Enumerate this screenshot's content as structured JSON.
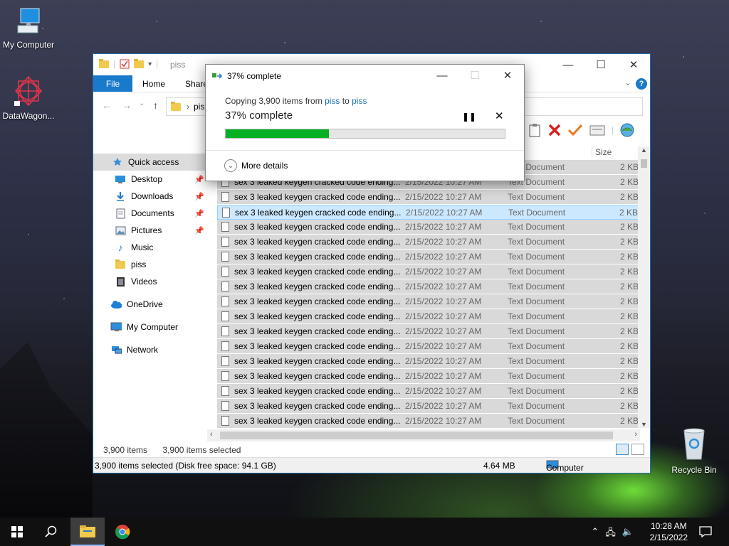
{
  "desktop": {
    "icons": [
      {
        "label": "My Computer"
      },
      {
        "label": "DataWagon..."
      },
      {
        "label": "Recycle Bin"
      }
    ]
  },
  "explorer": {
    "title": "piss",
    "tabs": [
      "File",
      "Home",
      "Share"
    ],
    "address": "pis",
    "sidebar": [
      {
        "label": "Quick access",
        "icon": "star-icon"
      },
      {
        "label": "Desktop",
        "icon": "desktop-icon",
        "pinned": true
      },
      {
        "label": "Downloads",
        "icon": "download-icon",
        "pinned": true
      },
      {
        "label": "Documents",
        "icon": "documents-icon",
        "pinned": true
      },
      {
        "label": "Pictures",
        "icon": "pictures-icon",
        "pinned": true
      },
      {
        "label": "Music",
        "icon": "music-icon"
      },
      {
        "label": "piss",
        "icon": "folder-icon"
      },
      {
        "label": "Videos",
        "icon": "videos-icon"
      },
      {
        "label": "OneDrive",
        "icon": "cloud-icon"
      },
      {
        "label": "My Computer",
        "icon": "computer-icon"
      },
      {
        "label": "Network",
        "icon": "network-icon"
      }
    ],
    "column_size": "Size",
    "first_row": {
      "type": "Text Document",
      "size": "2 KB"
    },
    "row": {
      "name": "sex 3 leaked keygen cracked code ending...",
      "date": "2/15/2022 10:27 AM",
      "type": "Text Document",
      "size": "2 KB"
    },
    "item_count": "3,900 items",
    "selected_count": "3,900 items selected",
    "status_left": "3,900 items selected (Disk free space: 94.1 GB)",
    "status_size": "4.64 MB",
    "status_location": "Computer"
  },
  "copy_dialog": {
    "title": "37% complete",
    "copy_prefix": "Copying 3,900 items from",
    "from": "piss",
    "to_word": "to",
    "to": "piss",
    "status": "37% complete",
    "progress": 0.37,
    "more_details": "More details"
  },
  "taskbar": {
    "time": "10:28 AM",
    "date": "2/15/2022"
  },
  "colors": {
    "accent": "#1979ca",
    "progress": "#06b025"
  }
}
